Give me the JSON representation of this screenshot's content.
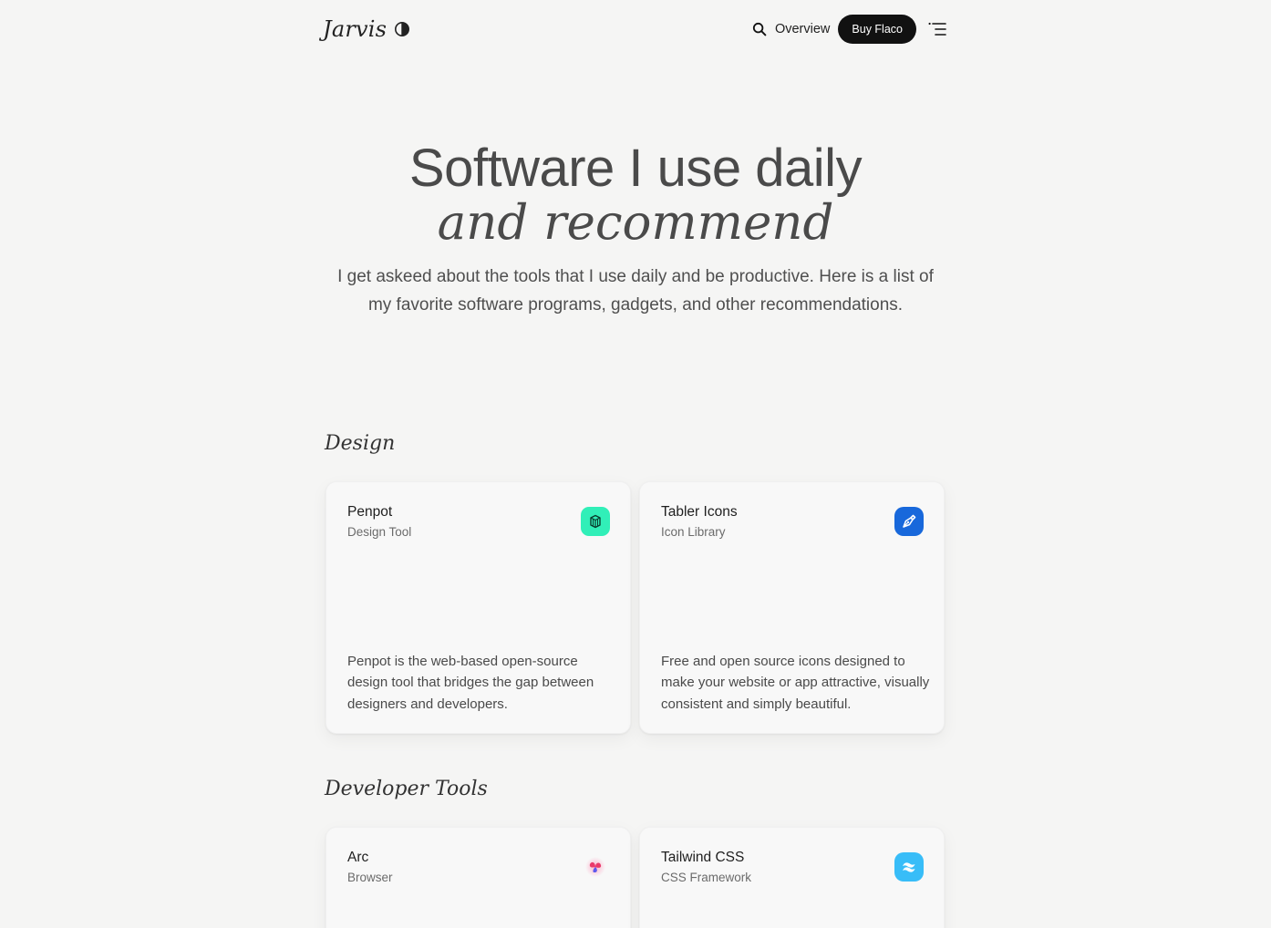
{
  "header": {
    "logo": "Jarvis",
    "nav_link": "Overview",
    "buy_button": "Buy Flaco"
  },
  "hero": {
    "title": "Software I use daily",
    "subtitle": "and recommend",
    "description": "I get askeed about the tools that I use daily and be productive. Here is a list of my favorite software programs, gadgets, and other recommendations."
  },
  "sections": [
    {
      "title": "Design",
      "cards": [
        {
          "name": "Penpot",
          "type": "Design Tool",
          "description": "Penpot is the web-based open-source design tool that bridges the gap between designers and developers.",
          "icon": "penpot-icon",
          "icon_color": "#31efb8"
        },
        {
          "name": "Tabler Icons",
          "type": "Icon Library",
          "description": "Free and open source icons designed to make your website or app attractive, visually consistent and simply beautiful.",
          "icon": "tabler-icon",
          "icon_color": "#1868db"
        }
      ]
    },
    {
      "title": "Developer Tools",
      "cards": [
        {
          "name": "Arc",
          "type": "Browser",
          "icon": "arc-icon",
          "icon_color": "#f0506e"
        },
        {
          "name": "Tailwind CSS",
          "type": "CSS Framework",
          "icon": "tailwind-icon",
          "icon_color": "#38bdf8"
        }
      ]
    }
  ]
}
